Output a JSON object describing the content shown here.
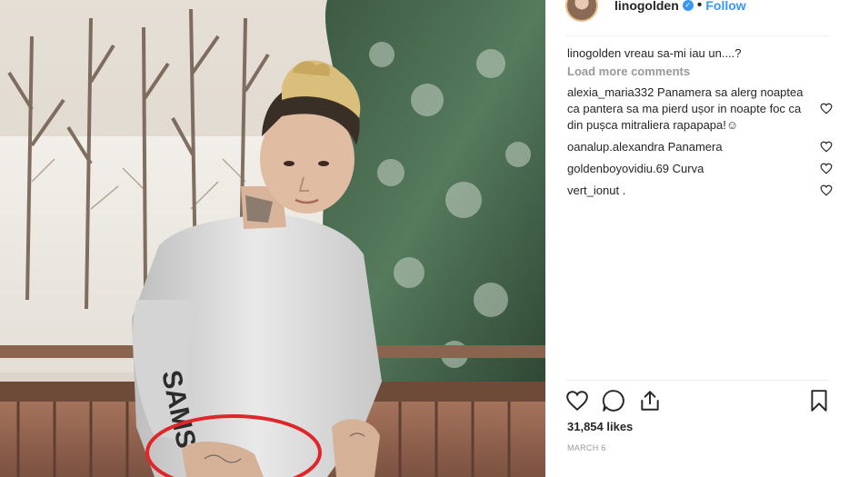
{
  "post": {
    "username": "linogolden",
    "follow_label": "Follow",
    "dot": "•",
    "verified_mark": "✓"
  },
  "caption": {
    "username": "linogolden",
    "text": "vreau sa-mi iau un....?"
  },
  "load_more": "Load more comments",
  "comments": [
    {
      "username": "alexia_maria332",
      "text": "Panamera sa alerg noaptea ca pantera sa ma pierd ușor in noapte foc ca din pușca mitraliera rapapapa!☺"
    },
    {
      "username": "oanalup.alexandra",
      "text": "Panamera"
    },
    {
      "username": "goldenboyovidiu.69",
      "text": "Curva"
    },
    {
      "username": "vert_ionut",
      "text": "."
    }
  ],
  "likes": "31,854 likes",
  "date": "MARCH 6",
  "icons": [
    "heart-icon",
    "comment-icon",
    "share-icon",
    "bookmark-icon",
    "like-comment-icon",
    "verified-icon"
  ],
  "colors": {
    "link": "#3897f0",
    "muted": "#999999",
    "text": "#262626",
    "annotation": "#e0262a"
  }
}
